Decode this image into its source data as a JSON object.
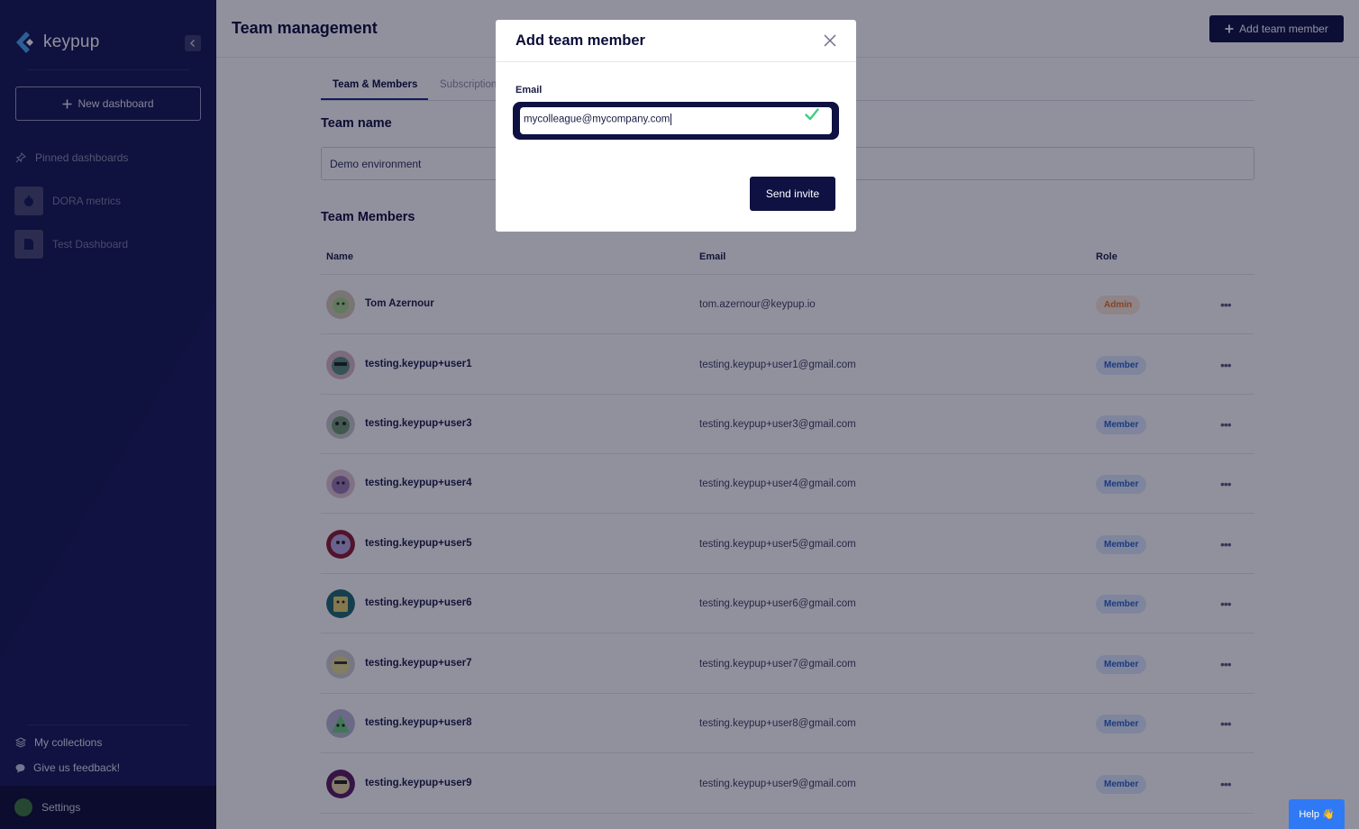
{
  "sidebar": {
    "logo_text": "keypup",
    "new_dashboard_label": "New dashboard",
    "pinned_label": "Pinned dashboards",
    "dashboards": [
      {
        "label": "DORA metrics",
        "icon": "timer-icon"
      },
      {
        "label": "Test Dashboard",
        "icon": "document-icon"
      }
    ],
    "my_collections_label": "My collections",
    "feedback_label": "Give us feedback!",
    "settings_label": "Settings"
  },
  "header": {
    "title": "Team management",
    "add_member_label": "Add team member"
  },
  "tabs": [
    {
      "label": "Team & Members",
      "active": true
    },
    {
      "label": "Subscription",
      "active": false
    }
  ],
  "team": {
    "name_heading": "Team name",
    "name_value": "Demo environment",
    "members_heading": "Team Members"
  },
  "table": {
    "columns": [
      "Name",
      "Email",
      "Role"
    ],
    "rows": [
      {
        "name": "Tom Azernour",
        "email": "tom.azernour@keypup.io",
        "role": "Admin"
      },
      {
        "name": "testing.keypup+user1",
        "email": "testing.keypup+user1@gmail.com",
        "role": "Member"
      },
      {
        "name": "testing.keypup+user3",
        "email": "testing.keypup+user3@gmail.com",
        "role": "Member"
      },
      {
        "name": "testing.keypup+user4",
        "email": "testing.keypup+user4@gmail.com",
        "role": "Member"
      },
      {
        "name": "testing.keypup+user5",
        "email": "testing.keypup+user5@gmail.com",
        "role": "Member"
      },
      {
        "name": "testing.keypup+user6",
        "email": "testing.keypup+user6@gmail.com",
        "role": "Member"
      },
      {
        "name": "testing.keypup+user7",
        "email": "testing.keypup+user7@gmail.com",
        "role": "Member"
      },
      {
        "name": "testing.keypup+user8",
        "email": "testing.keypup+user8@gmail.com",
        "role": "Member"
      },
      {
        "name": "testing.keypup+user9",
        "email": "testing.keypup+user9@gmail.com",
        "role": "Member"
      }
    ]
  },
  "help": {
    "label": "Help",
    "emoji": "👋"
  },
  "modal": {
    "title": "Add team member",
    "email_label": "Email",
    "email_value": "mycolleague@mycompany.com",
    "send_label": "Send invite"
  },
  "colors": {
    "sidebar_bg": "#131650",
    "primary": "#0e1142",
    "admin_badge": "#e8711f",
    "member_badge": "#2a63c9",
    "valid_check": "#3ccf7e",
    "help_button": "#2f79f5"
  }
}
